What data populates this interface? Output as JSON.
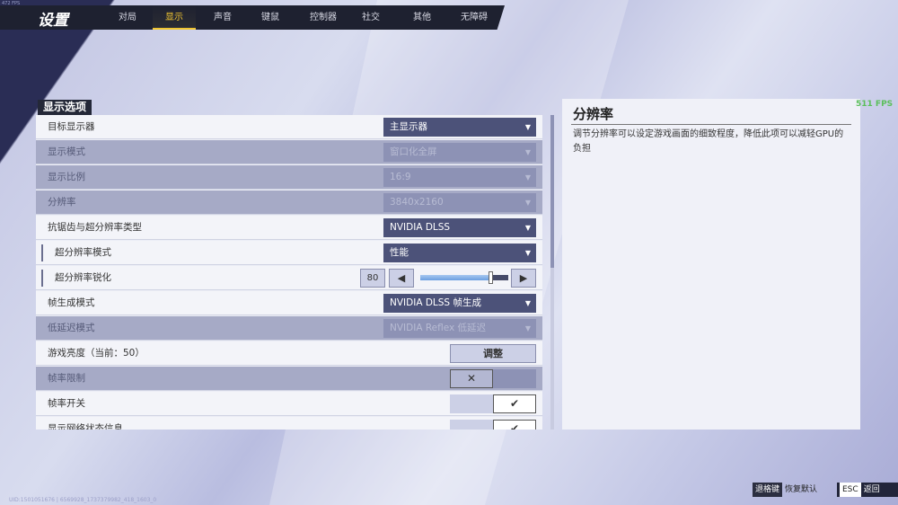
{
  "fps_corner": "472 FPS",
  "header": {
    "title": "设置",
    "tabs": [
      "对局",
      "显示",
      "声音",
      "键鼠",
      "控制器",
      "社交",
      "其他",
      "无障碍"
    ],
    "active_tab": 1
  },
  "section": "显示选项",
  "rows": [
    {
      "label": "目标显示器",
      "type": "dropdown",
      "value": "主显示器",
      "disabled": false
    },
    {
      "label": "显示模式",
      "type": "dropdown",
      "value": "窗口化全屏",
      "disabled": true
    },
    {
      "label": "显示比例",
      "type": "dropdown",
      "value": "16:9",
      "disabled": true
    },
    {
      "label": "分辨率",
      "type": "dropdown",
      "value": "3840x2160",
      "disabled": true
    },
    {
      "label": "抗锯齿与超分辨率类型",
      "type": "dropdown",
      "value": "NVIDIA DLSS",
      "disabled": false
    },
    {
      "label": "超分辨率模式",
      "type": "dropdown",
      "value": "性能",
      "disabled": false
    },
    {
      "label": "超分辨率锐化",
      "type": "slider",
      "value": "80",
      "fraction": 0.8
    },
    {
      "label": "帧生成模式",
      "type": "dropdown",
      "value": "NVIDIA DLSS 帧生成",
      "disabled": false
    },
    {
      "label": "低延迟模式",
      "type": "dropdown",
      "value": "NVIDIA Reflex 低延迟",
      "disabled": true
    },
    {
      "label": "游戏亮度（当前：50）",
      "type": "button",
      "value": "调整"
    },
    {
      "label": "帧率限制",
      "type": "toggle",
      "checked": false,
      "disabled": true
    },
    {
      "label": "帧率开关",
      "type": "toggle",
      "checked": true
    },
    {
      "label": "显示网络状态信息",
      "type": "toggle",
      "checked": true
    }
  ],
  "info": {
    "title": "分辨率",
    "description": "调节分辨率可以设定游戏画面的细致程度，降低此项可以减轻GPU的负担"
  },
  "fps": "511 FPS",
  "footer": {
    "reset_key": "退格键",
    "reset_label": "恢复默认",
    "back_key": "ESC",
    "back_label": "返回"
  },
  "uid": "UID:1501051676 | 6569928_1737379982_418_1603_0"
}
